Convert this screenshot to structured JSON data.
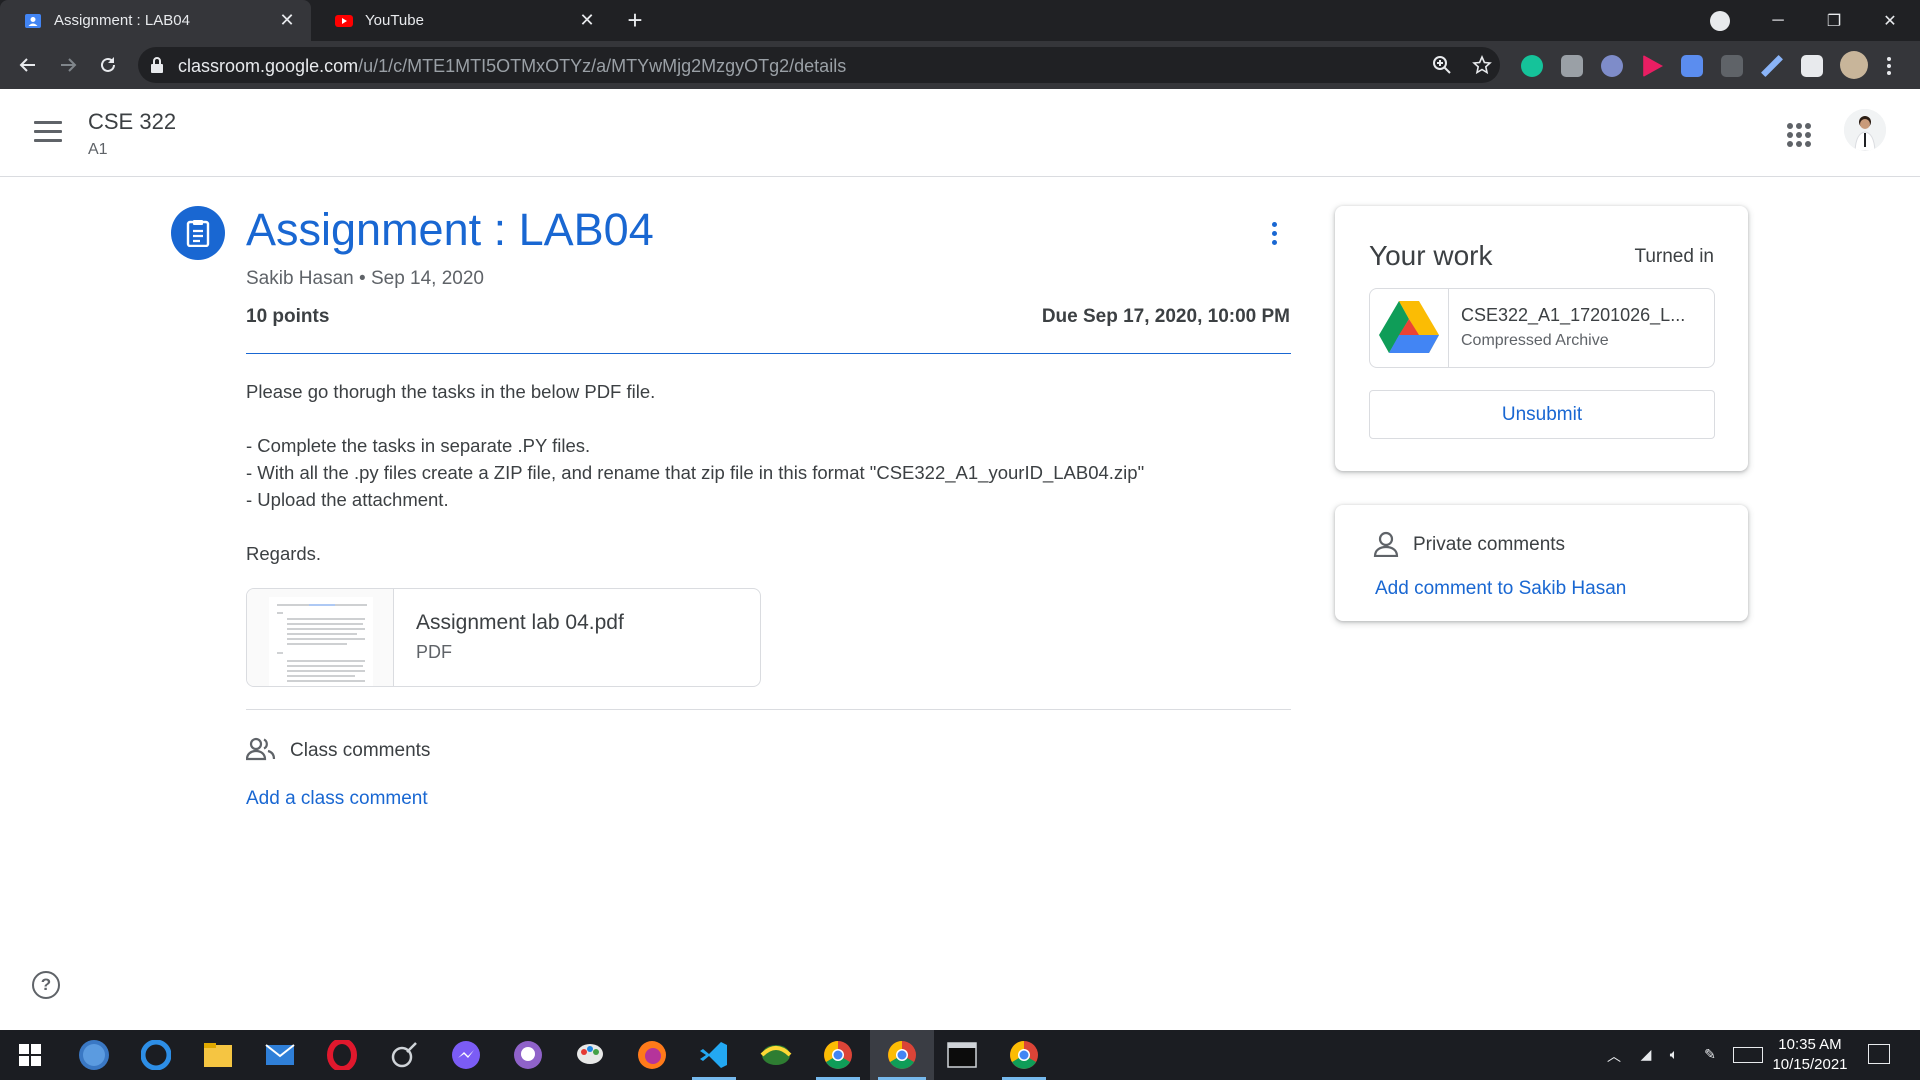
{
  "browser": {
    "tabs": [
      {
        "title": "Assignment : LAB04",
        "active": true
      },
      {
        "title": "YouTube",
        "active": false
      }
    ],
    "url_host": "classroom.google.com",
    "url_path": "/u/1/c/MTE1MTI5OTMxOTYz/a/MTYwMjg2MzgyOTg2/details"
  },
  "header": {
    "course": "CSE 322",
    "section": "A1"
  },
  "assignment": {
    "title": "Assignment : LAB04",
    "author": "Sakib Hasan",
    "separator": "•",
    "date": "Sep 14, 2020",
    "points": "10 points",
    "due": "Due Sep 17, 2020, 10:00 PM",
    "description": [
      "Please go thorugh the tasks in the below PDF file.",
      "",
      "- Complete the tasks in separate .PY files.",
      "- With all the .py files create a ZIP file, and rename that zip file in this format \"CSE322_A1_yourID_LAB04.zip\"",
      "- Upload the attachment.",
      "",
      "Regards."
    ],
    "attachment": {
      "name": "Assignment lab 04.pdf",
      "type": "PDF"
    }
  },
  "class_comments": {
    "label": "Class comments",
    "add": "Add a class comment"
  },
  "your_work": {
    "title": "Your work",
    "status": "Turned in",
    "file_name": "CSE322_A1_17201026_L...",
    "file_type": "Compressed Archive",
    "unsubmit": "Unsubmit"
  },
  "private_comments": {
    "label": "Private comments",
    "add": "Add comment to Sakib Hasan"
  },
  "taskbar": {
    "time": "10:35 AM",
    "date": "10/15/2021"
  },
  "colors": {
    "accent": "#1967d2",
    "tabstrip": "#202124",
    "toolbar": "#35363a",
    "taskbar": "#1b1d22"
  }
}
